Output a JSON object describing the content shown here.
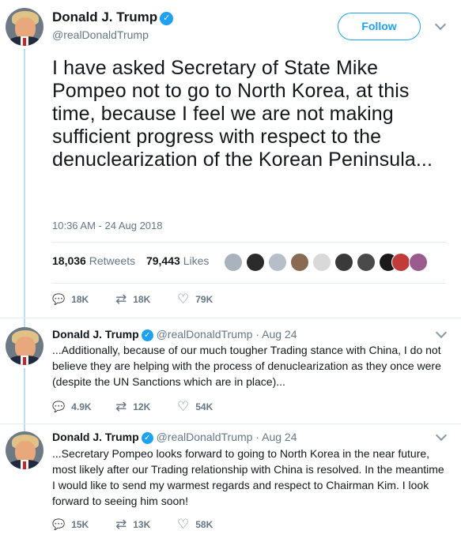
{
  "main_tweet": {
    "author_name": "Donald J. Trump",
    "author_handle": "@realDonaldTrump",
    "follow_label": "Follow",
    "text": "I have asked Secretary of State Mike Pompeo not to go to North Korea, at this time, because I feel we are not making sufficient progress with respect to the denuclearization of the Korean Peninsula...",
    "timestamp": "10:36 AM - 24 Aug 2018",
    "retweets_count": "18,036",
    "retweets_label": "Retweets",
    "likes_count": "79,443",
    "likes_label": "Likes",
    "actions": {
      "reply_count": "18K",
      "retweet_count": "18K",
      "like_count": "79K"
    }
  },
  "replies": [
    {
      "author_name": "Donald J. Trump",
      "author_handle": "@realDonaldTrump",
      "date": "Aug 24",
      "text": "...Additionally, because of our much tougher Trading stance with China, I do not believe they are helping with the process of denuclearization as they once were (despite the UN Sanctions which are in place)...",
      "reply_count": "4.9K",
      "retweet_count": "12K",
      "like_count": "54K"
    },
    {
      "author_name": "Donald J. Trump",
      "author_handle": "@realDonaldTrump",
      "date": "Aug 24",
      "text": "...Secretary Pompeo looks forward to going to North Korea in the near future, most likely after our Trading relationship with China is resolved. In the meantime I would like to send my warmest regards and respect to Chairman Kim. I look forward to seeing him soon!",
      "reply_count": "15K",
      "retweet_count": "13K",
      "like_count": "58K"
    }
  ],
  "icons": {
    "verified": "✓",
    "reply": "💬",
    "retweet": "⇄",
    "like": "♡"
  },
  "colors": {
    "accent": "#1da1f2",
    "text_secondary": "#657786",
    "thread_line": "#b8dff5"
  }
}
